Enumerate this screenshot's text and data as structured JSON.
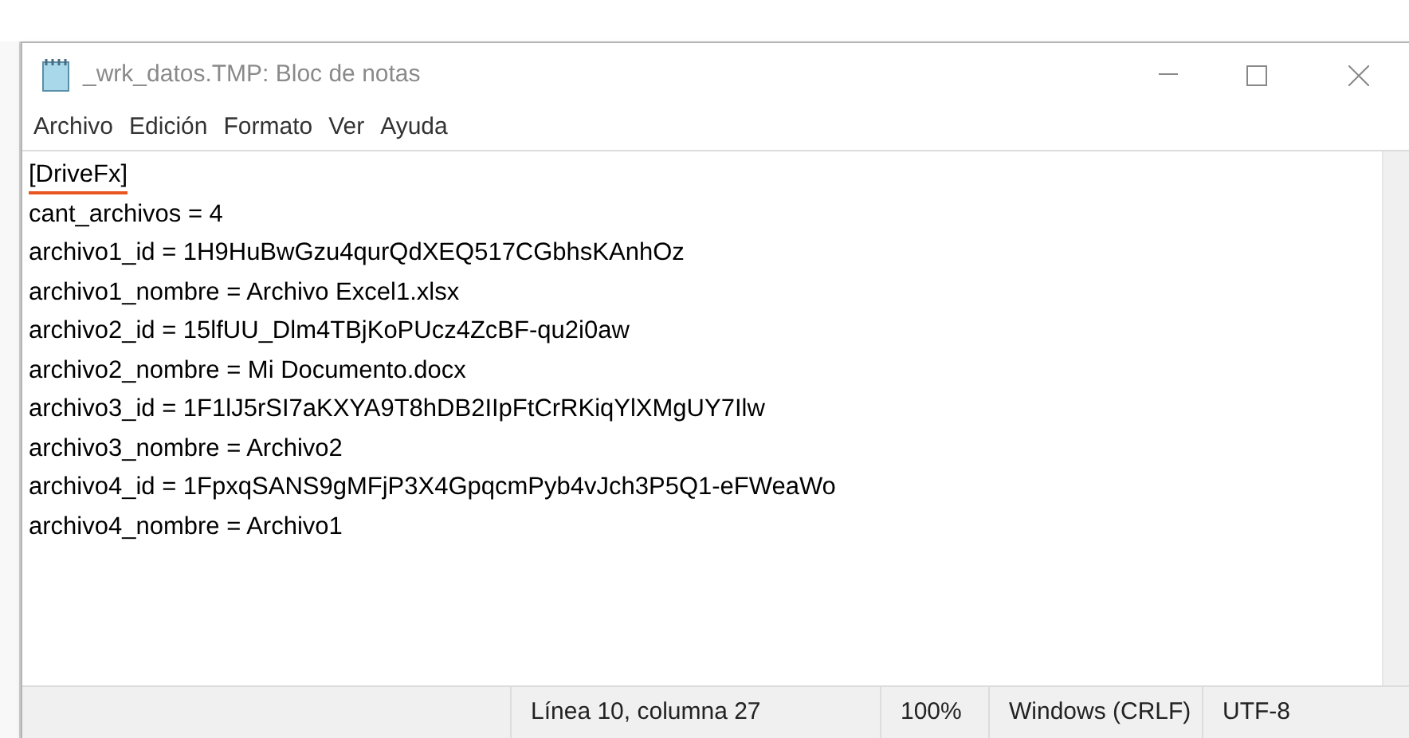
{
  "window": {
    "title": "_wrk_datos.TMP: Bloc de notas"
  },
  "menu": [
    "Archivo",
    "Edición",
    "Formato",
    "Ver",
    "Ayuda"
  ],
  "editor": {
    "lines": [
      {
        "text": "[DriveFx]",
        "marked": true
      },
      {
        "text": "cant_archivos = 4",
        "marked": false
      },
      {
        "text": "archivo1_id = 1H9HuBwGzu4qurQdXEQ517CGbhsKAnhOz",
        "marked": false
      },
      {
        "text": "archivo1_nombre = Archivo Excel1.xlsx",
        "marked": false
      },
      {
        "text": "archivo2_id = 15lfUU_Dlm4TBjKoPUcz4ZcBF-qu2i0aw",
        "marked": false
      },
      {
        "text": "archivo2_nombre = Mi Documento.docx",
        "marked": false
      },
      {
        "text": "archivo3_id = 1F1lJ5rSI7aKXYA9T8hDB2IIpFtCrRKiqYlXMgUY7Ilw",
        "marked": false
      },
      {
        "text": "archivo3_nombre = Archivo2",
        "marked": false
      },
      {
        "text": "archivo4_id = 1FpxqSANS9gMFjP3X4GpqcmPyb4vJch3P5Q1-eFWeaWo",
        "marked": false
      },
      {
        "text": "archivo4_nombre = Archivo1",
        "marked": false
      }
    ]
  },
  "status_bar": [
    "Línea 10, columna 27",
    "100%",
    "Windows (CRLF)",
    "UTF-8"
  ]
}
